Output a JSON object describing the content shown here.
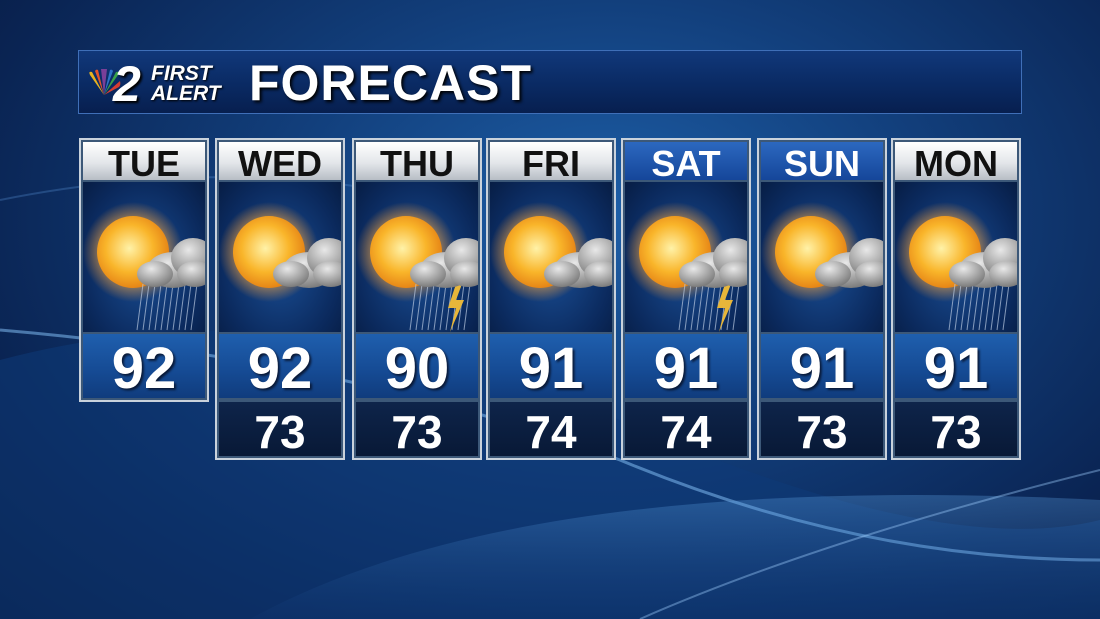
{
  "logo": {
    "channel_number": "2",
    "line1": "FIRST",
    "line2": "ALERT"
  },
  "title": "FORECAST",
  "days": [
    {
      "name": "TUE",
      "icon": "sun-cloud-rain-icon",
      "high": "92",
      "low": "",
      "weekend": false
    },
    {
      "name": "WED",
      "icon": "sun-cloud-icon",
      "high": "92",
      "low": "73",
      "weekend": false
    },
    {
      "name": "THU",
      "icon": "sun-cloud-thunderstorm-icon",
      "high": "90",
      "low": "73",
      "weekend": false
    },
    {
      "name": "FRI",
      "icon": "sun-cloud-icon",
      "high": "91",
      "low": "74",
      "weekend": false
    },
    {
      "name": "SAT",
      "icon": "sun-cloud-thunderstorm-icon",
      "high": "91",
      "low": "74",
      "weekend": true
    },
    {
      "name": "SUN",
      "icon": "sun-cloud-icon",
      "high": "91",
      "low": "73",
      "weekend": true
    },
    {
      "name": "MON",
      "icon": "sun-cloud-rain-icon",
      "high": "91",
      "low": "73",
      "weekend": false
    }
  ],
  "colors": {
    "sun": "#f7a521",
    "cloud": "#9a9a9a",
    "lightning": "#e7b63a",
    "weekend_header": "#15469a"
  }
}
